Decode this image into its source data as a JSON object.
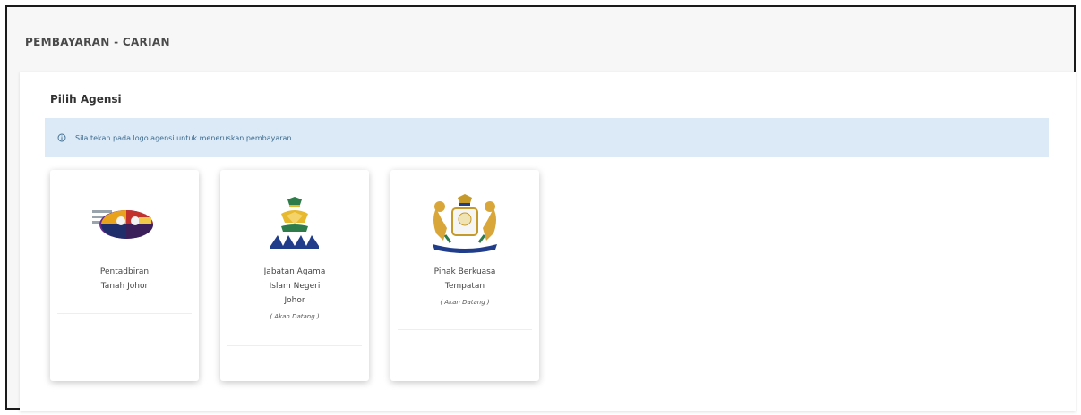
{
  "page": {
    "title": "PEMBAYARAN - CARIAN"
  },
  "panel": {
    "header": "Pilih Agensi",
    "info_message": "Sila tekan pada logo agensi untuk meneruskan pembayaran."
  },
  "colors": {
    "info_background": "#dbeaf6",
    "info_text": "#3d6b90"
  },
  "agencies": [
    {
      "icon": "ptj-logo-icon",
      "name_line1": "Pentadbiran",
      "name_line2": "Tanah Johor",
      "status": ""
    },
    {
      "icon": "jain-logo-icon",
      "name_line1": "Jabatan Agama",
      "name_line2": "Islam Negeri",
      "name_line3": "Johor",
      "status": "( Akan Datang )"
    },
    {
      "icon": "johor-crest-icon",
      "name_line1": "Pihak Berkuasa",
      "name_line2": "Tempatan",
      "status": "( Akan Datang )"
    }
  ]
}
